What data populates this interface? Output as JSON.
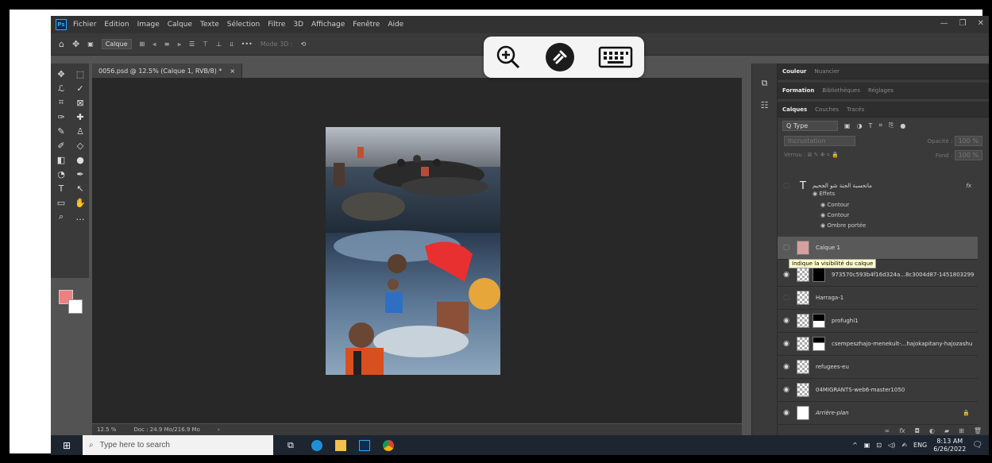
{
  "menu": {
    "logo": "Ps",
    "items": [
      "Fichier",
      "Edition",
      "Image",
      "Calque",
      "Texte",
      "Sélection",
      "Filtre",
      "3D",
      "Affichage",
      "Fenêtre",
      "Aide"
    ]
  },
  "options": {
    "auto_select_value": "Calque",
    "mode3d_label": "Mode 3D :"
  },
  "document": {
    "tab_title": "0056.psd @ 12.5% (Calque 1, RVB/8) *",
    "close": "×"
  },
  "status": {
    "zoom": "12.5 %",
    "doc_size": "Doc : 24.9 Mo/216.9 Mo",
    "arrow": "›"
  },
  "panels": {
    "row1": [
      "Couleur",
      "Nuancier"
    ],
    "row2": [
      "Formation",
      "Bibliothèques",
      "Réglages"
    ],
    "row3": [
      "Calques",
      "Couches",
      "Tracés"
    ],
    "filter_label": "Q Type",
    "blend_mode": "Incrustation",
    "opacity_label": "Opacité :",
    "opacity_value": "100 %",
    "lock_label": "Verrou :",
    "fill_label": "Fond :",
    "fill_value": "100 %"
  },
  "layers": {
    "text_layer": "ماتحسبة الجنة شو الجحيم",
    "effects_label": "Effets",
    "effects": [
      "Contour",
      "Contour",
      "Ombre portée"
    ],
    "fx": "fx",
    "calque1": "Calque 1",
    "tooltip": "Indique la visibilité du calque",
    "items": [
      "973570c593b4f16d324a...8c3004d87-1451803299",
      "Harraga-1",
      "profughi1",
      "csempeszhajo-menekult-...hajokapitany-hajozashu",
      "refugees-eu",
      "04MIGRANTS-web6-master1050",
      "Arrière-plan"
    ]
  },
  "taskbar": {
    "search_placeholder": "Type here to search",
    "lang": "ENG",
    "time": "8:13 AM",
    "date": "6/26/2022"
  },
  "colors": {
    "foreground": "#f08080",
    "background": "#ffffff",
    "accent": "#31a8ff"
  }
}
